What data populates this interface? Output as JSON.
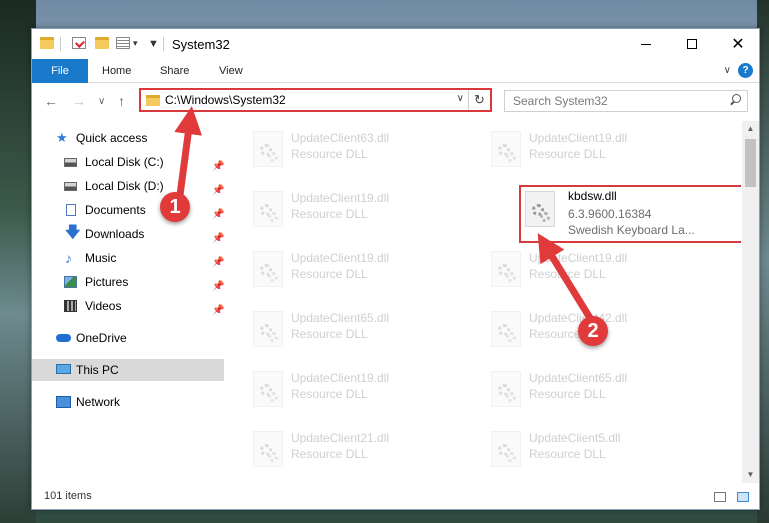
{
  "window": {
    "title": "System32"
  },
  "ribbon": {
    "tabs": [
      "File",
      "Home",
      "Share",
      "View"
    ],
    "help": "?"
  },
  "nav": {
    "address": "C:\\Windows\\System32",
    "search_placeholder": "Search System32"
  },
  "sidebar": {
    "quick_access": "Quick access",
    "items": [
      {
        "label": "Local Disk (C:)",
        "icon": "disk-icon"
      },
      {
        "label": "Local Disk (D:)",
        "icon": "disk-icon"
      },
      {
        "label": "Documents",
        "icon": "documents-icon"
      },
      {
        "label": "Downloads",
        "icon": "downloads-icon"
      },
      {
        "label": "Music",
        "icon": "music-icon"
      },
      {
        "label": "Pictures",
        "icon": "pictures-icon"
      },
      {
        "label": "Videos",
        "icon": "videos-icon"
      }
    ],
    "onedrive": "OneDrive",
    "this_pc": "This PC",
    "network": "Network"
  },
  "files": [
    {
      "name": "UpdateClient63.dll",
      "sub": "Resource DLL"
    },
    {
      "name": "UpdateClient19.dll",
      "sub": "Resource DLL"
    },
    {
      "name": "UpdateClient19.dll",
      "sub": "Resource DLL"
    },
    {
      "name": "kbdsw.dll",
      "version": "6.3.9600.16384",
      "desc": "Swedish Keyboard La..."
    },
    {
      "name": "UpdateClient19.dll",
      "sub": "Resource DLL"
    },
    {
      "name": "UpdateClient19.dll",
      "sub": "Resource DLL"
    },
    {
      "name": "UpdateClient65.dll",
      "sub": "Resource DLL"
    },
    {
      "name": "UpdateClient42.dll",
      "sub": "Resource DLL"
    },
    {
      "name": "UpdateClient19.dll",
      "sub": "Resource DLL"
    },
    {
      "name": "UpdateClient65.dll",
      "sub": "Resource DLL"
    },
    {
      "name": "UpdateClient21.dll",
      "sub": "Resource DLL"
    },
    {
      "name": "UpdateClient5.dll",
      "sub": "Resource DLL"
    }
  ],
  "status": {
    "item_count": "101 items"
  },
  "annotations": {
    "step1": "1",
    "step2": "2",
    "color": "#e03a3b"
  }
}
